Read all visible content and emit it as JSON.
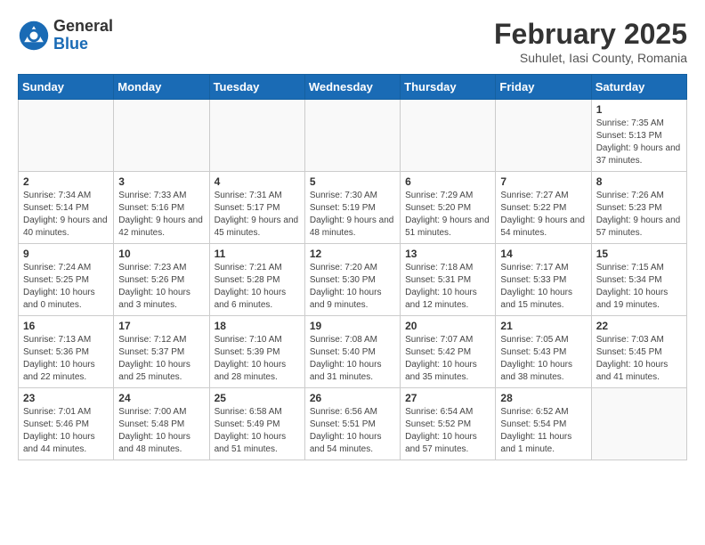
{
  "header": {
    "logo_general": "General",
    "logo_blue": "Blue",
    "title": "February 2025",
    "location": "Suhulet, Iasi County, Romania"
  },
  "days_of_week": [
    "Sunday",
    "Monday",
    "Tuesday",
    "Wednesday",
    "Thursday",
    "Friday",
    "Saturday"
  ],
  "weeks": [
    [
      {
        "day": "",
        "info": ""
      },
      {
        "day": "",
        "info": ""
      },
      {
        "day": "",
        "info": ""
      },
      {
        "day": "",
        "info": ""
      },
      {
        "day": "",
        "info": ""
      },
      {
        "day": "",
        "info": ""
      },
      {
        "day": "1",
        "info": "Sunrise: 7:35 AM\nSunset: 5:13 PM\nDaylight: 9 hours and 37 minutes."
      }
    ],
    [
      {
        "day": "2",
        "info": "Sunrise: 7:34 AM\nSunset: 5:14 PM\nDaylight: 9 hours and 40 minutes."
      },
      {
        "day": "3",
        "info": "Sunrise: 7:33 AM\nSunset: 5:16 PM\nDaylight: 9 hours and 42 minutes."
      },
      {
        "day": "4",
        "info": "Sunrise: 7:31 AM\nSunset: 5:17 PM\nDaylight: 9 hours and 45 minutes."
      },
      {
        "day": "5",
        "info": "Sunrise: 7:30 AM\nSunset: 5:19 PM\nDaylight: 9 hours and 48 minutes."
      },
      {
        "day": "6",
        "info": "Sunrise: 7:29 AM\nSunset: 5:20 PM\nDaylight: 9 hours and 51 minutes."
      },
      {
        "day": "7",
        "info": "Sunrise: 7:27 AM\nSunset: 5:22 PM\nDaylight: 9 hours and 54 minutes."
      },
      {
        "day": "8",
        "info": "Sunrise: 7:26 AM\nSunset: 5:23 PM\nDaylight: 9 hours and 57 minutes."
      }
    ],
    [
      {
        "day": "9",
        "info": "Sunrise: 7:24 AM\nSunset: 5:25 PM\nDaylight: 10 hours and 0 minutes."
      },
      {
        "day": "10",
        "info": "Sunrise: 7:23 AM\nSunset: 5:26 PM\nDaylight: 10 hours and 3 minutes."
      },
      {
        "day": "11",
        "info": "Sunrise: 7:21 AM\nSunset: 5:28 PM\nDaylight: 10 hours and 6 minutes."
      },
      {
        "day": "12",
        "info": "Sunrise: 7:20 AM\nSunset: 5:30 PM\nDaylight: 10 hours and 9 minutes."
      },
      {
        "day": "13",
        "info": "Sunrise: 7:18 AM\nSunset: 5:31 PM\nDaylight: 10 hours and 12 minutes."
      },
      {
        "day": "14",
        "info": "Sunrise: 7:17 AM\nSunset: 5:33 PM\nDaylight: 10 hours and 15 minutes."
      },
      {
        "day": "15",
        "info": "Sunrise: 7:15 AM\nSunset: 5:34 PM\nDaylight: 10 hours and 19 minutes."
      }
    ],
    [
      {
        "day": "16",
        "info": "Sunrise: 7:13 AM\nSunset: 5:36 PM\nDaylight: 10 hours and 22 minutes."
      },
      {
        "day": "17",
        "info": "Sunrise: 7:12 AM\nSunset: 5:37 PM\nDaylight: 10 hours and 25 minutes."
      },
      {
        "day": "18",
        "info": "Sunrise: 7:10 AM\nSunset: 5:39 PM\nDaylight: 10 hours and 28 minutes."
      },
      {
        "day": "19",
        "info": "Sunrise: 7:08 AM\nSunset: 5:40 PM\nDaylight: 10 hours and 31 minutes."
      },
      {
        "day": "20",
        "info": "Sunrise: 7:07 AM\nSunset: 5:42 PM\nDaylight: 10 hours and 35 minutes."
      },
      {
        "day": "21",
        "info": "Sunrise: 7:05 AM\nSunset: 5:43 PM\nDaylight: 10 hours and 38 minutes."
      },
      {
        "day": "22",
        "info": "Sunrise: 7:03 AM\nSunset: 5:45 PM\nDaylight: 10 hours and 41 minutes."
      }
    ],
    [
      {
        "day": "23",
        "info": "Sunrise: 7:01 AM\nSunset: 5:46 PM\nDaylight: 10 hours and 44 minutes."
      },
      {
        "day": "24",
        "info": "Sunrise: 7:00 AM\nSunset: 5:48 PM\nDaylight: 10 hours and 48 minutes."
      },
      {
        "day": "25",
        "info": "Sunrise: 6:58 AM\nSunset: 5:49 PM\nDaylight: 10 hours and 51 minutes."
      },
      {
        "day": "26",
        "info": "Sunrise: 6:56 AM\nSunset: 5:51 PM\nDaylight: 10 hours and 54 minutes."
      },
      {
        "day": "27",
        "info": "Sunrise: 6:54 AM\nSunset: 5:52 PM\nDaylight: 10 hours and 57 minutes."
      },
      {
        "day": "28",
        "info": "Sunrise: 6:52 AM\nSunset: 5:54 PM\nDaylight: 11 hours and 1 minute."
      },
      {
        "day": "",
        "info": ""
      }
    ]
  ]
}
